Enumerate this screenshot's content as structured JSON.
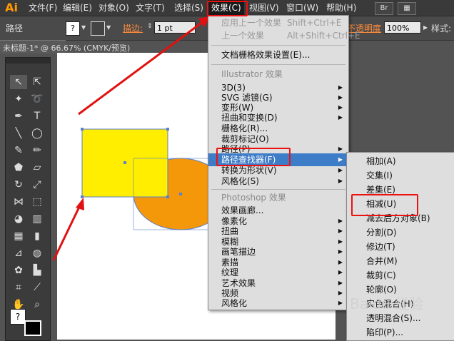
{
  "app": {
    "logo": "Ai"
  },
  "menubar": {
    "items": [
      "文件(F)",
      "编辑(E)",
      "对象(O)",
      "文字(T)",
      "选择(S)",
      "效果(C)",
      "视图(V)",
      "窗口(W)",
      "帮助(H)"
    ],
    "br_label": "Br"
  },
  "control_bar": {
    "mode_label": "路径",
    "stroke_label": "描边:",
    "stroke_value": "1 pt",
    "opacity_label": "不透明度",
    "opacity_value": "100%",
    "style_label": "样式:"
  },
  "document": {
    "tab_title": "未标题-1* @ 66.67% (CMYK/预览)"
  },
  "effect_menu": {
    "items": [
      {
        "label": "应用上一个效果",
        "shortcut": "Shift+Ctrl+E",
        "disabled": true
      },
      {
        "label": "上一个效果",
        "shortcut": "Alt+Shift+Ctrl+E",
        "disabled": true
      },
      {
        "label": "文档栅格效果设置(E)..."
      },
      {
        "label": "Illustrator 效果",
        "header": true
      },
      {
        "label": "3D(3)",
        "submenu": true
      },
      {
        "label": "SVG 滤镜(G)",
        "submenu": true
      },
      {
        "label": "变形(W)",
        "submenu": true
      },
      {
        "label": "扭曲和变换(D)",
        "submenu": true
      },
      {
        "label": "栅格化(R)..."
      },
      {
        "label": "裁剪标记(O)"
      },
      {
        "label": "路径(P)",
        "submenu": true
      },
      {
        "label": "路径查找器(F)",
        "submenu": true,
        "highlighted": true
      },
      {
        "label": "转换为形状(V)",
        "submenu": true
      },
      {
        "label": "风格化(S)",
        "submenu": true
      },
      {
        "label": "Photoshop 效果",
        "header": true
      },
      {
        "label": "效果画廊..."
      },
      {
        "label": "像素化",
        "submenu": true
      },
      {
        "label": "扭曲",
        "submenu": true
      },
      {
        "label": "模糊",
        "submenu": true
      },
      {
        "label": "画笔描边",
        "submenu": true
      },
      {
        "label": "素描",
        "submenu": true
      },
      {
        "label": "纹理",
        "submenu": true
      },
      {
        "label": "艺术效果",
        "submenu": true
      },
      {
        "label": "视频",
        "submenu": true
      },
      {
        "label": "风格化",
        "submenu": true
      }
    ]
  },
  "pathfinder_submenu": {
    "items": [
      "相加(A)",
      "交集(I)",
      "差集(E)",
      "相减(U)",
      "减去后方对象(B)",
      "分割(D)",
      "修边(T)",
      "合并(M)",
      "裁剪(C)",
      "轮廓(O)",
      "实色混合(H)",
      "透明混合(S)...",
      "陷印(P)..."
    ]
  },
  "watermark": "Baidu 经验",
  "colors": {
    "yellow": "#ffee00",
    "orange": "#f4980a",
    "highlight": "#3d7cc7",
    "annotation_red": "#e11111"
  }
}
